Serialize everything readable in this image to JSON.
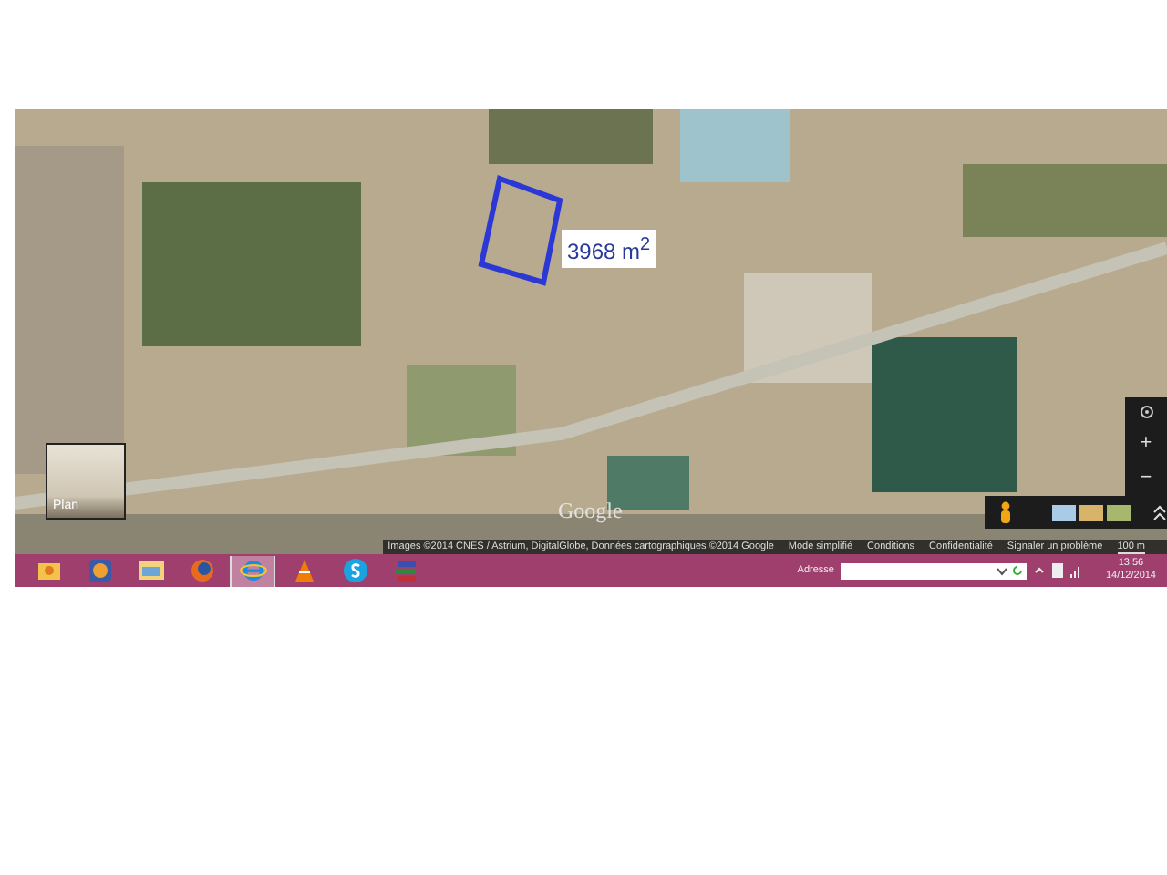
{
  "map": {
    "area_label": "3968 m$^{2}$",
    "layer_thumbnail": {
      "label": "Plan"
    },
    "logo": "Google",
    "zoom_in": "+",
    "zoom_out": "−"
  },
  "attribution": {
    "imagery": "Images ©2014 CNES / Astrium, DigitalGlobe, Données cartographiques ©2014 Google",
    "links": [
      "Mode simplifié",
      "Conditions",
      "Confidentialité",
      "Signaler un problème"
    ],
    "scale": "100 m"
  },
  "taskbar": {
    "apps": [
      {
        "kind": "folder",
        "selected": false
      },
      {
        "kind": "media",
        "selected": false
      },
      {
        "kind": "explorer",
        "selected": false
      },
      {
        "kind": "firefox",
        "selected": false
      },
      {
        "kind": "ie",
        "selected": true
      },
      {
        "kind": "vlc",
        "selected": false
      },
      {
        "kind": "skype",
        "selected": false
      },
      {
        "kind": "books",
        "selected": false
      }
    ],
    "address": {
      "label": "Adresse"
    },
    "time": "13:56",
    "date": "14/12/2014"
  }
}
